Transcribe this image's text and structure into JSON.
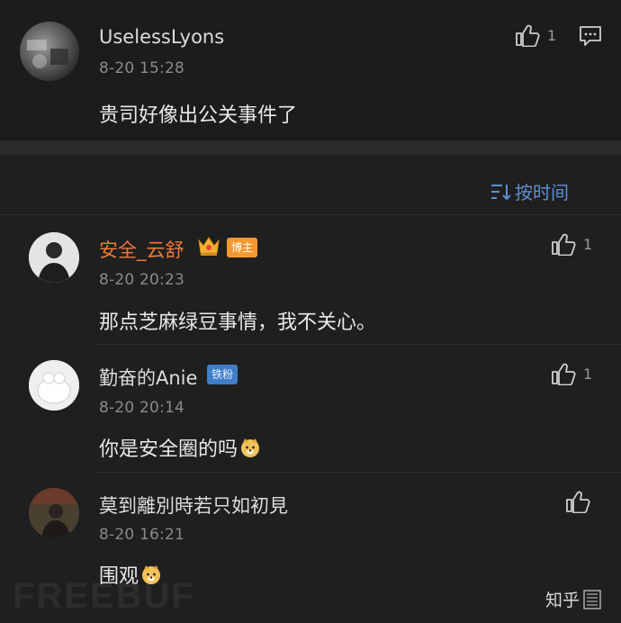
{
  "top_comment": {
    "username": "UselessLyons",
    "timestamp": "8-20 15:28",
    "content": "贵司好像出公关事件了",
    "likes": "1"
  },
  "sort": {
    "label": "按时间"
  },
  "comments": [
    {
      "username": "安全_云舒",
      "badge": "博主",
      "timestamp": "8-20 20:23",
      "content": "那点芝麻绿豆事情，我不关心。",
      "likes": "1"
    },
    {
      "username": "勤奋的Anie",
      "badge": "铁粉",
      "timestamp": "8-20 20:14",
      "content": "你是安全圈的吗",
      "likes": "1"
    },
    {
      "username": "莫到離別時若只如初見",
      "timestamp": "8-20 16:21",
      "content": "围观",
      "likes": ""
    }
  ],
  "watermark": {
    "left": "FREEBUF",
    "right": "知乎"
  },
  "colors": {
    "accent_blue": "#5a8fd8",
    "username_orange": "#f07a3b",
    "author_badge": "#f39a2e",
    "fan_badge": "#3f7ec9"
  }
}
